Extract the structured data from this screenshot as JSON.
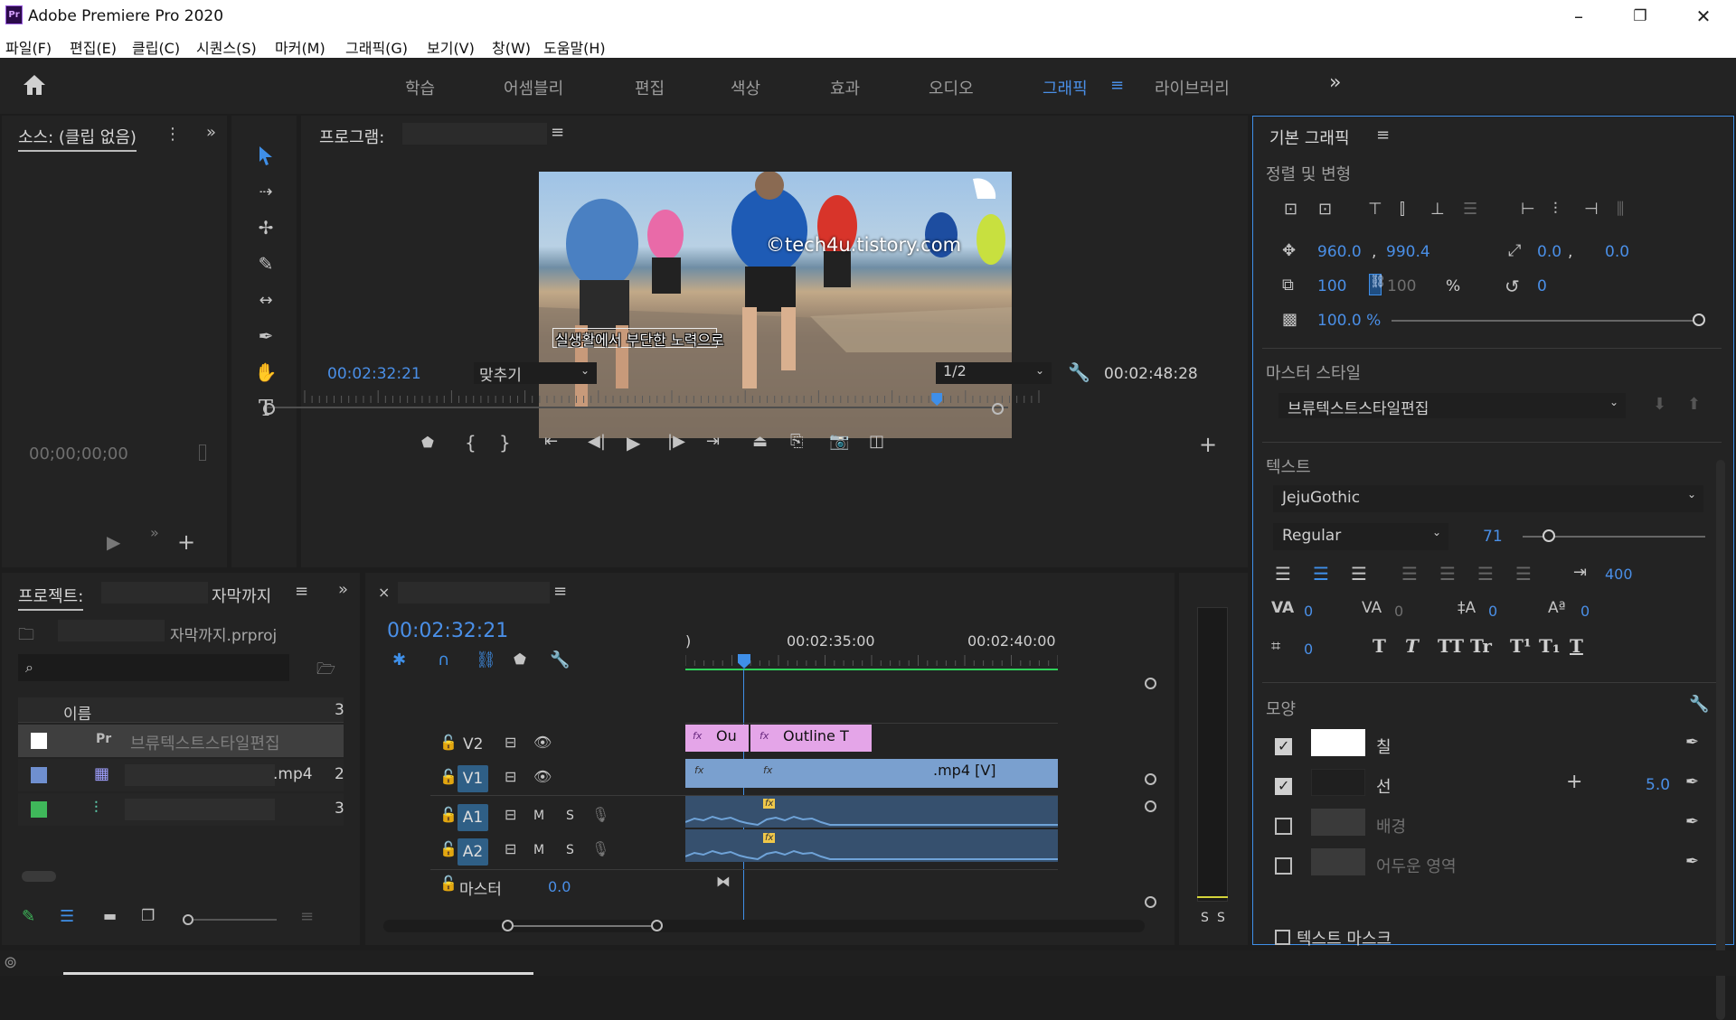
{
  "window": {
    "title": "Adobe Premiere Pro 2020",
    "app_icon": "Pr",
    "minimize": "–",
    "restore": "❐",
    "close": "✕"
  },
  "menu": [
    "파일(F)",
    "편집(E)",
    "클립(C)",
    "시퀀스(S)",
    "마커(M)",
    "그래픽(G)",
    "보기(V)",
    "창(W)",
    "도움말(H)"
  ],
  "workspaces": {
    "items": [
      "학습",
      "어셈블리",
      "편집",
      "색상",
      "효과",
      "오디오",
      "그래픽",
      "라이브러리"
    ],
    "active": "그래픽",
    "more": "»"
  },
  "source": {
    "title": "소스: (클립 없음)",
    "timecode": "00;00;00;00"
  },
  "program": {
    "title": "프로그램:",
    "overlay_watermark": "©tech4u.tistory.com",
    "overlay_caption": "실생활에서 부단한 노력으로",
    "timecode_current": "00:02:32:21",
    "fit": "맞추기",
    "resolution": "1/2",
    "timecode_total": "00:02:48:28",
    "playhead_fraction": 0.904
  },
  "project": {
    "title": "프로젝트:",
    "title_suffix": "자막까지",
    "file": "자막까지.prproj",
    "col_name": "이름",
    "col_more": "3",
    "items": [
      {
        "color": "#ffffff",
        "name": "브류텍스트스타일편집",
        "icon": "text-style-icon",
        "val": ""
      },
      {
        "color": "#6f8fcf",
        "name": ".mp4",
        "icon": "video-clip-icon",
        "val": "2"
      },
      {
        "color": "#3fb75a",
        "name": "",
        "icon": "sequence-icon",
        "val": "3"
      }
    ]
  },
  "timeline": {
    "timecode": "00:02:32:21",
    "ruler": [
      ")",
      "00:02:35:00",
      "00:02:40:00"
    ],
    "tracks": {
      "v2": "V2",
      "v1": "V1",
      "a1": "A1",
      "a2": "A2",
      "mute": "M",
      "solo": "S",
      "master": "마스터",
      "master_val": "0.0"
    },
    "clips": {
      "v2_a": "Ou",
      "v2_b": "Outline T",
      "v1": ".mp4 [V]",
      "fx": "fx"
    }
  },
  "meter": {
    "s1": "S",
    "s2": "S"
  },
  "essential_graphics": {
    "title": "기본 그래픽",
    "align_section": "정렬 및 변형",
    "pos_x": "960.0",
    "pos_sep": ",",
    "pos_y": "990.4",
    "anchor_x": "0.0",
    "anchor_sep": ",",
    "anchor_y": "0.0",
    "scale": "100",
    "scale_linked": "100",
    "scale_unit": "%",
    "rotation": "0",
    "opacity": "100.0 %",
    "master_style_section": "마스터 스타일",
    "master_style": "브류텍스트스타일편집",
    "text_section": "텍스트",
    "font": "JejuGothic",
    "font_style": "Regular",
    "font_size": "71",
    "tracking_box": "400",
    "kerning": "0",
    "tracking": "0",
    "baseline": "0",
    "tsume": "0",
    "leading": "0",
    "text_styles": [
      "T",
      "T",
      "TT",
      "Tr",
      "T¹",
      "T₁",
      "T"
    ],
    "appearance_section": "모양",
    "fill": {
      "label": "칠",
      "checked": true,
      "color": "#ffffff"
    },
    "stroke": {
      "label": "선",
      "checked": true,
      "width": "5.0",
      "color": "#1f1f1f"
    },
    "background": {
      "label": "배경",
      "checked": false
    },
    "shadow": {
      "label": "어두운 영역",
      "checked": false
    },
    "text_mask": "텍스트 마스크"
  }
}
